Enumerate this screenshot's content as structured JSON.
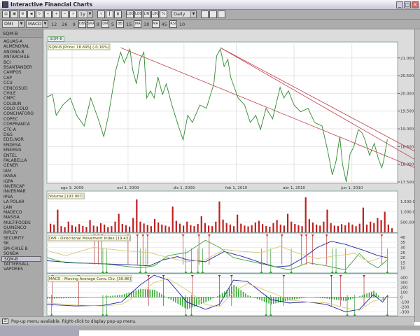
{
  "window": {
    "title": "Interactive Financial Charts",
    "minimize": "_",
    "maximize": "□",
    "close": "✕"
  },
  "toolbar1": {
    "icons": [
      "print-icon",
      "save-icon",
      "settings-icon",
      "sound-icon",
      "refresh-icon",
      "scroll-left-icon",
      "zoom-in-icon",
      "zoom-out-icon",
      "scroll-right-icon"
    ],
    "icon_glyphs": [
      "▤",
      "▣",
      "⚙",
      "◀",
      "↻",
      "«",
      "+",
      "−",
      "»"
    ],
    "period": "1y",
    "chart_icons": [
      "line-chart-icon",
      "bar-chart-icon",
      "candle-chart-icon"
    ],
    "chart_glyphs": [
      "∿",
      "┃",
      "▮"
    ],
    "scale_labels": [
      "LOG",
      "LOG",
      "LIN",
      "LIN",
      "%"
    ],
    "interval": "Daily",
    "right_icons": [
      "color-icon",
      "layout-icon",
      "panel-icon"
    ]
  },
  "toolbar2": {
    "indicator1": "DMI",
    "indicator2": "MACD",
    "macd_params": [
      "12",
      "26",
      "9"
    ],
    "buttons": [
      {
        "label": "SMA",
        "value": "9"
      },
      {
        "label": "DM",
        "value": "5"
      },
      {
        "label": "BB",
        "value": "15"
      },
      {
        "label": "MA",
        "value": "30"
      },
      {
        "label": "MA",
        "value": "45"
      },
      {
        "label": "RSI",
        "value": "10"
      }
    ],
    "first_button": "OBV"
  },
  "sidebar": {
    "selected": "SQM-B",
    "items": [
      "AGUAS-A",
      "ALMENDRAL",
      "ANDINA-B",
      "ANTARCHILE",
      "BCI",
      "BSANTANDER",
      "CAMPOS",
      "CAP",
      "CCU",
      "CENCOSUD",
      "CHILE",
      "CMPC",
      "COLBUN",
      "COLO COLO",
      "CONCHATORO",
      "COPEC",
      "CORPBANCA",
      "CTC-A",
      "D&S",
      "EDELNOR",
      "ENDESA",
      "ENERSIS",
      "ENTEL",
      "FALABELLA",
      "GENER",
      "IAM",
      "IANSA",
      "IGPA",
      "INVERCAP",
      "INVERMAR",
      "IPSA",
      "LA POLAR",
      "LAN",
      "MADECO",
      "MASISA",
      "MULTIFOODS",
      "QUINENCO",
      "RIPLEY",
      "SECURITY",
      "SK",
      "SM-CHILE B",
      "SONDA",
      "SQM-B",
      "TATTERSALL",
      "VAPORES"
    ]
  },
  "status": {
    "text": "Pop-up menu available. Right-click to display pop-up menu."
  },
  "chart_data": [
    {
      "type": "line",
      "legend": "SQM-B",
      "title": "SQM-B [Price: 18.695] (-0.16%)",
      "days_span": 376,
      "xticks": [
        {
          "day": 27,
          "label": "ago 3, 2009"
        },
        {
          "day": 87,
          "label": "oct 1, 2009"
        },
        {
          "day": 147,
          "label": "dic 1, 2009"
        },
        {
          "day": 203,
          "label": "feb 1, 2010"
        },
        {
          "day": 265,
          "label": "abr 1, 2010"
        },
        {
          "day": 327,
          "label": "jun 1, 2010"
        }
      ],
      "ylim": [
        17.46,
        21.45
      ],
      "yticks": [
        "17.500",
        "18.000",
        "18.500",
        "19.000",
        "19.500",
        "20.000",
        "20.500",
        "21.000"
      ],
      "series": [
        [
          0,
          19.9
        ],
        [
          6,
          19.97
        ],
        [
          10,
          19.38
        ],
        [
          17,
          19.67
        ],
        [
          25,
          19.87
        ],
        [
          32,
          19.38
        ],
        [
          40,
          19.08
        ],
        [
          47,
          19.87
        ],
        [
          55,
          19.28
        ],
        [
          61,
          18.78
        ],
        [
          66,
          19.38
        ],
        [
          74,
          20.66
        ],
        [
          79,
          21.16
        ],
        [
          83,
          20.86
        ],
        [
          89,
          21.25
        ],
        [
          92,
          20.66
        ],
        [
          96,
          20.27
        ],
        [
          100,
          20.96
        ],
        [
          104,
          21.16
        ],
        [
          107,
          19.87
        ],
        [
          111,
          20.07
        ],
        [
          115,
          19.87
        ],
        [
          119,
          20.46
        ],
        [
          124,
          19.97
        ],
        [
          128,
          20.27
        ],
        [
          134,
          19.67
        ],
        [
          141,
          19.08
        ],
        [
          146,
          18.69
        ],
        [
          151,
          19.38
        ],
        [
          156,
          19.18
        ],
        [
          164,
          19.67
        ],
        [
          171,
          19.58
        ],
        [
          179,
          20.27
        ],
        [
          182,
          21.06
        ],
        [
          186,
          21.25
        ],
        [
          190,
          20.76
        ],
        [
          194,
          20.96
        ],
        [
          197,
          20.46
        ],
        [
          205,
          19.87
        ],
        [
          212,
          19.67
        ],
        [
          218,
          19.18
        ],
        [
          224,
          19.38
        ],
        [
          229,
          18.98
        ],
        [
          235,
          19.58
        ],
        [
          242,
          19.28
        ],
        [
          250,
          20.17
        ],
        [
          254,
          19.87
        ],
        [
          259,
          20.07
        ],
        [
          265,
          19.67
        ],
        [
          272,
          19.48
        ],
        [
          280,
          19.58
        ],
        [
          287,
          19.18
        ],
        [
          295,
          19.08
        ],
        [
          301,
          18.39
        ],
        [
          306,
          17.7
        ],
        [
          310,
          18.09
        ],
        [
          314,
          18.78
        ],
        [
          317,
          17.99
        ],
        [
          321,
          17.5
        ],
        [
          325,
          18.29
        ],
        [
          329,
          18.49
        ],
        [
          334,
          18.98
        ],
        [
          338,
          18.88
        ],
        [
          341,
          18.69
        ],
        [
          346,
          18.25
        ],
        [
          351,
          18.59
        ],
        [
          355,
          18.19
        ],
        [
          359,
          17.9
        ],
        [
          361,
          18.09
        ],
        [
          365,
          18.7
        ]
      ],
      "trendlines": [
        [
          [
            79,
            21.29
          ],
          [
            395,
            17.86
          ]
        ],
        [
          [
            186,
            21.29
          ],
          [
            395,
            18.29
          ]
        ],
        [
          [
            186,
            21.29
          ],
          [
            395,
            18.05
          ]
        ]
      ],
      "colors": {
        "line": "#2e8b2e",
        "trend": "#c04050"
      }
    },
    {
      "type": "bar",
      "title": "Volume [193.907]",
      "ylim": [
        0,
        2000000
      ],
      "yticks": [
        {
          "v": 500000,
          "label": "500.000"
        },
        {
          "v": 1000000,
          "label": "1.000.000"
        },
        {
          "v": 1500000,
          "label": "1.500.000"
        }
      ],
      "values_k": [
        420,
        380,
        1100,
        300,
        260,
        520,
        350,
        280,
        400,
        310,
        270,
        600,
        330,
        290,
        450,
        380,
        260,
        300,
        520,
        900,
        410,
        350,
        280,
        700,
        1600,
        520,
        430,
        360,
        300,
        650,
        480,
        380,
        330,
        280,
        1250,
        560,
        420,
        330,
        520,
        360,
        300,
        410,
        780,
        450,
        330,
        300,
        520,
        1500,
        620,
        450,
        380,
        300,
        860,
        420,
        330,
        290,
        350,
        480,
        560,
        400,
        310,
        280,
        450,
        600,
        380,
        330,
        900,
        520,
        410,
        350,
        300,
        1700,
        640,
        480,
        380,
        330,
        520,
        1100,
        450,
        330,
        310,
        400,
        350,
        480,
        380,
        300,
        420,
        1200,
        380,
        520,
        450,
        700,
        600,
        1000,
        380,
        200
      ],
      "color": "#c02020"
    },
    {
      "type": "line",
      "title": "DMI - Directional Movement Index [19.43]",
      "ylim": [
        5,
        44
      ],
      "yticks": [
        10,
        15,
        20,
        25,
        30,
        35,
        40
      ],
      "series": [
        {
          "name": "ADX",
          "color": "#2020a0",
          "points": [
            [
              0,
              17
            ],
            [
              30,
              15
            ],
            [
              60,
              14
            ],
            [
              90,
              13
            ],
            [
              110,
              12
            ],
            [
              125,
              18
            ],
            [
              140,
              21
            ],
            [
              150,
              18
            ],
            [
              170,
              16
            ],
            [
              190,
              26
            ],
            [
              210,
              21
            ],
            [
              230,
              15
            ],
            [
              245,
              11
            ],
            [
              260,
              12
            ],
            [
              275,
              20
            ],
            [
              290,
              30
            ],
            [
              305,
              36
            ],
            [
              320,
              33
            ],
            [
              340,
              27
            ],
            [
              355,
              22
            ],
            [
              365,
              20
            ]
          ]
        },
        {
          "name": "+DI",
          "color": "#40a040",
          "points": [
            [
              0,
              20
            ],
            [
              20,
              15
            ],
            [
              60,
              14
            ],
            [
              100,
              10
            ],
            [
              115,
              12
            ],
            [
              130,
              22
            ],
            [
              150,
              25
            ],
            [
              170,
              37
            ],
            [
              185,
              30
            ],
            [
              200,
              20
            ],
            [
              230,
              14
            ],
            [
              260,
              8
            ],
            [
              280,
              15
            ],
            [
              300,
              12
            ],
            [
              320,
              8
            ],
            [
              335,
              24
            ],
            [
              345,
              15
            ],
            [
              355,
              10
            ],
            [
              365,
              18
            ]
          ]
        },
        {
          "name": "-DI",
          "color": "#d8c870",
          "points": [
            [
              0,
              27
            ],
            [
              20,
              22
            ],
            [
              50,
              30
            ],
            [
              80,
              27
            ],
            [
              110,
              25
            ],
            [
              130,
              20
            ],
            [
              150,
              16
            ],
            [
              170,
              18
            ],
            [
              190,
              28
            ],
            [
              210,
              26
            ],
            [
              230,
              25
            ],
            [
              250,
              31
            ],
            [
              270,
              24
            ],
            [
              290,
              19
            ],
            [
              310,
              22
            ],
            [
              330,
              24
            ],
            [
              345,
              16
            ],
            [
              365,
              22
            ]
          ]
        }
      ],
      "sell_signals": [
        51,
        55,
        59,
        87,
        97,
        103,
        108,
        146,
        163,
        174,
        236,
        252,
        273,
        278,
        285,
        300,
        359
      ],
      "buy_signals": [
        60,
        64,
        100,
        106,
        149,
        155,
        162,
        167,
        230,
        240,
        262,
        306,
        310,
        320,
        365
      ]
    },
    {
      "type": "line",
      "title": "MACD - Moving Average Conv. Div. [30.86]",
      "ylim": [
        -380,
        480
      ],
      "yticks": [
        {
          "v": 400,
          "label": "400"
        },
        {
          "v": 300,
          "label": "300"
        },
        {
          "v": 200,
          "label": "200"
        },
        {
          "v": 100,
          "label": "100"
        },
        {
          "v": 0,
          "label": "0"
        },
        {
          "v": -100,
          "label": "-100"
        },
        {
          "v": -200,
          "label": "-200"
        },
        {
          "v": -300,
          "label": "-300"
        }
      ],
      "series": [
        {
          "name": "MACD",
          "color": "#2020a0",
          "points": [
            [
              0,
              -150
            ],
            [
              30,
              -180
            ],
            [
              60,
              -170
            ],
            [
              80,
              -100
            ],
            [
              100,
              250
            ],
            [
              115,
              450
            ],
            [
              130,
              350
            ],
            [
              150,
              -100
            ],
            [
              170,
              -250
            ],
            [
              185,
              -150
            ],
            [
              200,
              350
            ],
            [
              215,
              320
            ],
            [
              240,
              -50
            ],
            [
              260,
              -120
            ],
            [
              280,
              -100
            ],
            [
              300,
              -150
            ],
            [
              320,
              -300
            ],
            [
              335,
              -250
            ],
            [
              350,
              50
            ],
            [
              360,
              -100
            ],
            [
              365,
              30
            ]
          ]
        },
        {
          "name": "Signal",
          "color": "#d8c870",
          "points": [
            [
              0,
              -120
            ],
            [
              30,
              -160
            ],
            [
              60,
              -180
            ],
            [
              80,
              -150
            ],
            [
              100,
              80
            ],
            [
              115,
              300
            ],
            [
              130,
              380
            ],
            [
              150,
              150
            ],
            [
              170,
              -150
            ],
            [
              185,
              -200
            ],
            [
              200,
              100
            ],
            [
              215,
              280
            ],
            [
              240,
              100
            ],
            [
              260,
              -60
            ],
            [
              280,
              -100
            ],
            [
              300,
              -120
            ],
            [
              320,
              -220
            ],
            [
              335,
              -270
            ],
            [
              350,
              -80
            ],
            [
              360,
              -40
            ],
            [
              365,
              0
            ]
          ]
        }
      ],
      "histogram_color": "#20a020",
      "sell_signals": [
        6,
        34,
        109,
        125,
        156,
        185,
        198,
        254,
        305,
        315,
        340
      ],
      "buy_signals": [
        5,
        60,
        64,
        149,
        155,
        235,
        240,
        322,
        330,
        365
      ]
    }
  ]
}
